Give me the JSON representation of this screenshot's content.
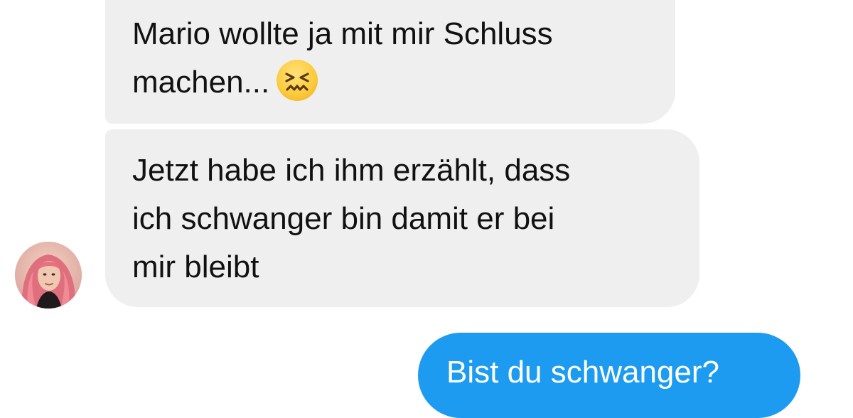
{
  "conversation": {
    "messages": [
      {
        "sender": "contact",
        "lines": [
          "Mario wollte ja mit mir Schluss",
          "machen..."
        ],
        "emoji": "persevering-face-icon"
      },
      {
        "sender": "contact",
        "lines": [
          "Jetzt habe ich ihm erzählt, dass",
          "ich schwanger bin damit er bei",
          "mir bleibt"
        ]
      },
      {
        "sender": "me",
        "text": "Bist du schwanger?"
      }
    ]
  },
  "colors": {
    "incoming_bubble": "#efefef",
    "outgoing_bubble": "#1c9bf0",
    "text": "#111111",
    "outgoing_text": "#ffffff"
  },
  "icons": {
    "avatar": "contact-avatar-photo",
    "emoji": "persevering-face-icon"
  }
}
